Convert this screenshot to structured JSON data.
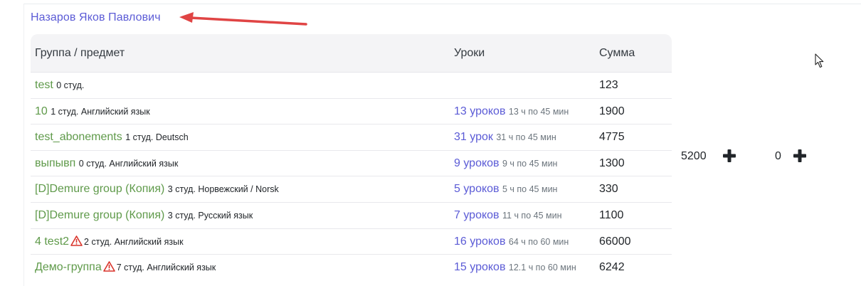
{
  "teacher": {
    "name": "Назаров Яков Павлович"
  },
  "table": {
    "headers": {
      "group": "Группа / предмет",
      "lessons": "Уроки",
      "sum": "Сумма"
    },
    "rows": [
      {
        "name": "test",
        "meta": "0 студ.",
        "warning": false,
        "lessons": "",
        "lessons_meta": "",
        "sum": "123"
      },
      {
        "name": "10",
        "meta": "1 студ. Английский язык",
        "warning": false,
        "lessons": "13 уроков",
        "lessons_meta": "13 ч по 45 мин",
        "sum": "1900"
      },
      {
        "name": "test_abonements",
        "meta": "1 студ. Deutsch",
        "warning": false,
        "lessons": "31 урок",
        "lessons_meta": "31 ч по 45 мин",
        "sum": "4775"
      },
      {
        "name": "выпывп",
        "meta": "0 студ. Английский язык",
        "warning": false,
        "lessons": "9 уроков",
        "lessons_meta": "9 ч по 45 мин",
        "sum": "1300"
      },
      {
        "name": "[D]Demure group (Копия)",
        "meta": "3 студ. Норвежский / Norsk",
        "warning": false,
        "lessons": "5 уроков",
        "lessons_meta": "5 ч по 45 мин",
        "sum": "330"
      },
      {
        "name": "[D]Demure group (Копия)",
        "meta": "3 студ. Русский язык",
        "warning": false,
        "lessons": "7 уроков",
        "lessons_meta": "11 ч по 45 мин",
        "sum": "1100"
      },
      {
        "name": "4 test2",
        "meta": "2 студ. Английский язык",
        "warning": true,
        "lessons": "16 уроков",
        "lessons_meta": "64 ч по 60 мин",
        "sum": "66000"
      },
      {
        "name": "Демо-группа",
        "meta": "7 студ. Английский язык",
        "warning": true,
        "lessons": "15 уроков",
        "lessons_meta": "12.1 ч по 60 мин",
        "sum": "6242"
      }
    ]
  },
  "totals": {
    "first": "5200",
    "second": "0"
  },
  "icons": {
    "warning": "warning-triangle-icon",
    "plus": "plus-icon",
    "arrow": "red-arrow",
    "cursor": "mouse-cursor-icon"
  },
  "colors": {
    "link": "#5b5bd6",
    "group": "#5f9a4a",
    "warning": "#d9342b",
    "arrow": "#e04444"
  }
}
